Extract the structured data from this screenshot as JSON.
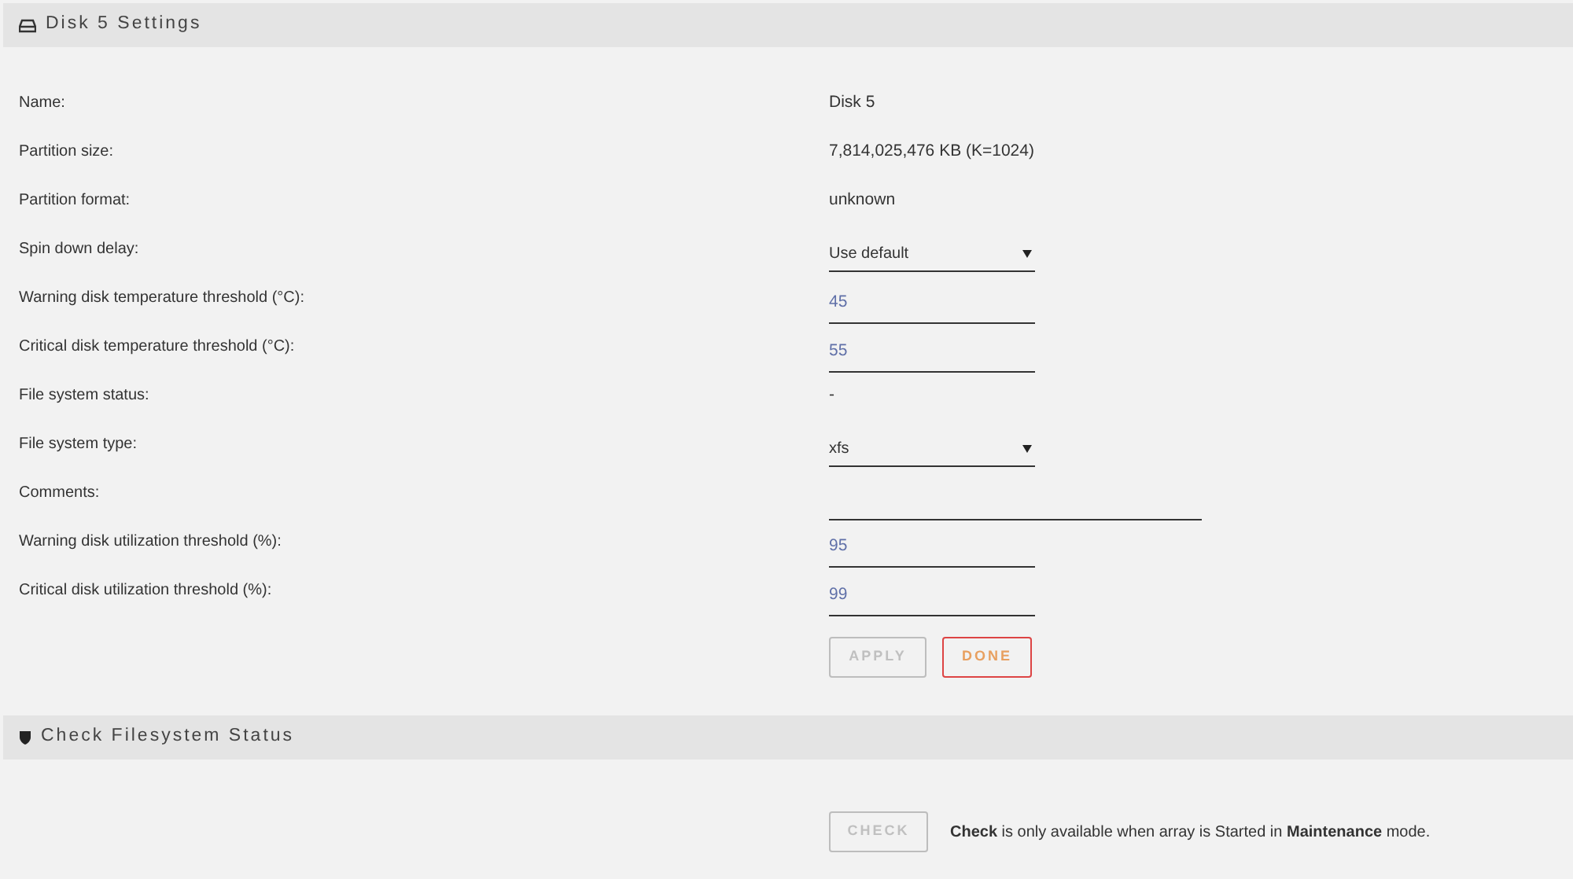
{
  "settings_panel": {
    "title": "Disk 5 Settings",
    "rows": [
      {
        "label": "Name:",
        "kind": "text",
        "value": "Disk 5"
      },
      {
        "label": "Partition size:",
        "kind": "text",
        "value": "7,814,025,476 KB (K=1024)"
      },
      {
        "label": "Partition format:",
        "kind": "text",
        "value": "unknown"
      },
      {
        "label": "Spin down delay:",
        "kind": "select",
        "value": "Use default"
      },
      {
        "label": "Warning disk temperature threshold (°C):",
        "kind": "input",
        "value": "45"
      },
      {
        "label": "Critical disk temperature threshold (°C):",
        "kind": "input",
        "value": "55"
      },
      {
        "label": "File system status:",
        "kind": "text",
        "value": "-"
      },
      {
        "label": "File system type:",
        "kind": "select",
        "value": "xfs"
      },
      {
        "label": "Comments:",
        "kind": "wide_input"
      },
      {
        "label": "Warning disk utilization threshold (%):",
        "kind": "input",
        "value": "95"
      },
      {
        "label": "Critical disk utilization threshold (%):",
        "kind": "input",
        "value": "99"
      }
    ],
    "buttons": [
      {
        "label": "APPLY",
        "disabled": true
      },
      {
        "label": "DONE",
        "disabled": false
      }
    ]
  },
  "check_panel": {
    "title": "Check Filesystem Status",
    "button": {
      "label": "CHECK",
      "disabled": true
    },
    "note": "**Check** is only available when array is Started in **Maintenance** mode."
  }
}
